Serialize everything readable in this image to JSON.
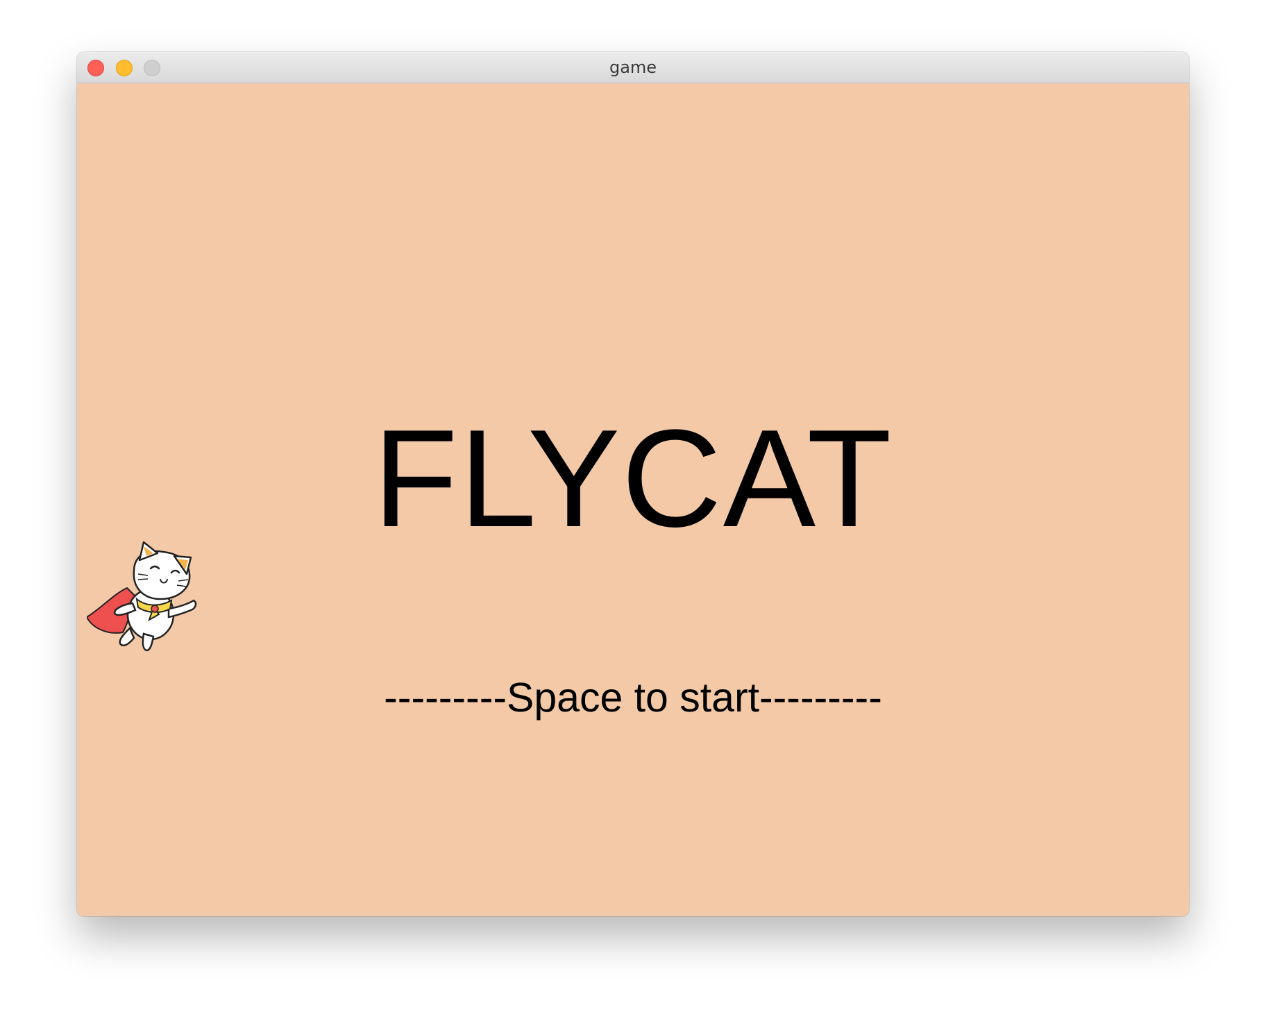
{
  "window": {
    "title": "game"
  },
  "game": {
    "title": "FLYCAT",
    "start_prompt": "---------Space to start---------",
    "background_color": "#f4c9a7",
    "player_sprite": "flying-cat-with-red-cape"
  },
  "colors": {
    "close": "#fe5f57",
    "minimize": "#febc2e",
    "zoom": "#cfcfcf",
    "cape": "#ee4f4f",
    "scarf": "#f7d84a"
  }
}
